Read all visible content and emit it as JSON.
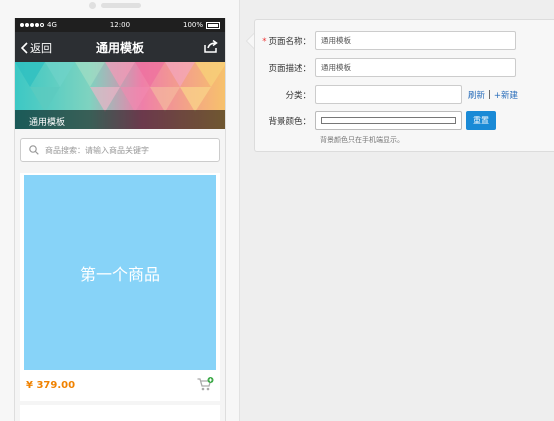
{
  "statusbar": {
    "carrier": "4G",
    "time": "12:00",
    "battery": "100%"
  },
  "navbar": {
    "back_label": "返回",
    "title": "通用模板"
  },
  "banner": {
    "label": "通用模板"
  },
  "search": {
    "placeholder": "商品搜索：请输入商品关键字"
  },
  "product": {
    "name": "第一个商品",
    "price": "¥ 379.00"
  },
  "form": {
    "page_name_label": "页面名称：",
    "page_name_required": "*",
    "page_name_value": "通用模板",
    "page_desc_label": "页面描述：",
    "page_desc_value": "通用模板",
    "category_label": "分类：",
    "refresh_link": "刷新",
    "separator": "|",
    "new_link": "+新建",
    "bg_color_label": "背景颜色：",
    "reset_button": "重置",
    "bg_hint": "背景颜色只在手机端显示。"
  },
  "colors": {
    "accent_blue": "#1a8ad6",
    "price_orange": "#f08200",
    "product_bg": "#87d3f8",
    "nav_dark": "#2c2f33"
  }
}
